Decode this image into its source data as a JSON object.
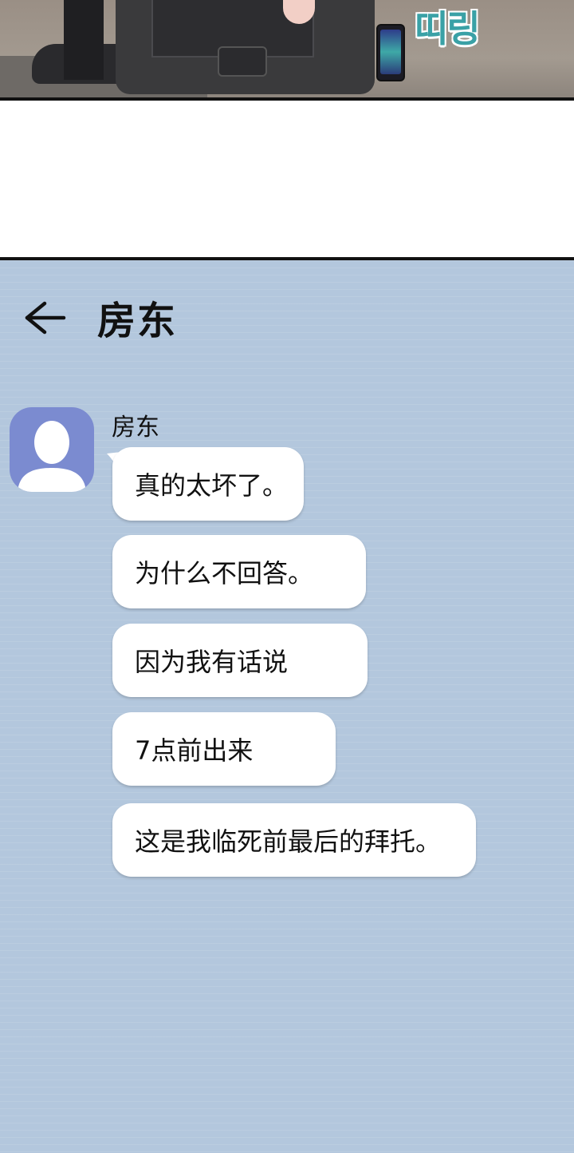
{
  "comic": {
    "sound_effect": "띠링"
  },
  "chat": {
    "title": "房东",
    "back_icon": "arrow-left-icon",
    "sender": {
      "name": "房东",
      "avatar_icon": "person-silhouette-icon"
    },
    "messages": [
      "真的太坏了。",
      "为什么不回答。",
      "因为我有话说",
      "7点前出来",
      "这是我临死前最后的拜托。"
    ],
    "colors": {
      "background": "#b3c7dd",
      "bubble": "#ffffff",
      "avatar": "#7b8bd0",
      "sound_effect": "#3aa1a6"
    }
  }
}
